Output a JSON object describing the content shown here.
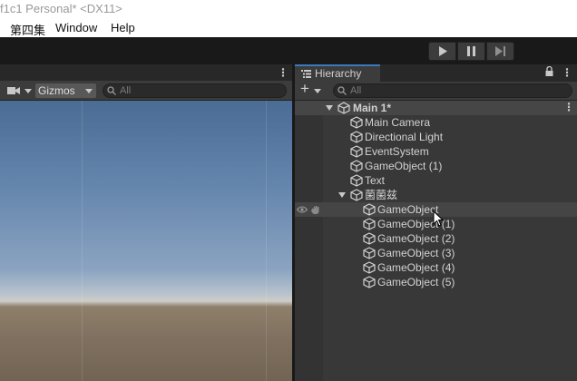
{
  "window": {
    "title": "f1c1 Personal* <DX11>"
  },
  "menu": {
    "items": [
      "第四集",
      "Window",
      "Help"
    ]
  },
  "toolbar": {
    "play": "play-icon",
    "pause": "pause-icon",
    "step": "step-icon"
  },
  "scene": {
    "gizmos_label": "Gizmos",
    "search_placeholder": "All"
  },
  "hierarchy": {
    "tab_label": "Hierarchy",
    "search_placeholder": "All",
    "scene_name": "Main 1*",
    "objects": [
      "Main Camera",
      "Directional Light",
      "EventSystem",
      "GameObject (1)",
      "Text",
      "菌菌兹"
    ],
    "children": [
      "GameObject",
      "GameObject (1)",
      "GameObject (2)",
      "GameObject (3)",
      "GameObject (4)",
      "GameObject (5)"
    ]
  },
  "colors": {
    "accent": "#3a79bb",
    "panel": "#383838",
    "text": "#d2d2d2"
  }
}
